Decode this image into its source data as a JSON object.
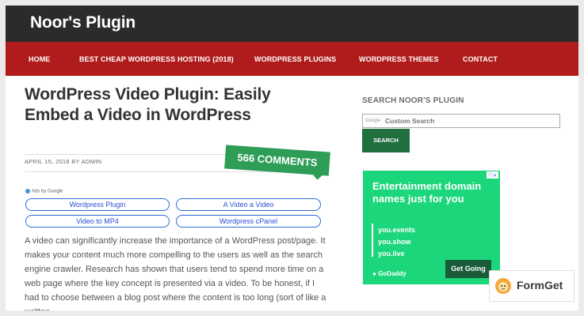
{
  "site": {
    "title": "Noor's Plugin"
  },
  "nav": {
    "items": [
      {
        "label": "HOME"
      },
      {
        "label": "BEST CHEAP WORDPRESS HOSTING (2018)"
      },
      {
        "label": "WORDPRESS PLUGINS"
      },
      {
        "label": "WORDPRESS THEMES"
      },
      {
        "label": "CONTACT"
      }
    ]
  },
  "post": {
    "title_line1": "WordPress Video Plugin: Easily",
    "title_line2": "Embed a Video in WordPress",
    "meta": "APRIL 15, 2018 BY ADMIN",
    "comments": "566 COMMENTS",
    "body": "A video can significantly increase the importance of a WordPress post/page. It makes your content much more compelling to the users as well as the search engine crawler. Research has shown that users tend to spend more time on a web page where the key concept is presented via a video. To be honest, if I had to choose between a blog post where the content is too long (sort of like a written"
  },
  "ads": {
    "label": "Ads by Google",
    "links": [
      {
        "label": "Wordpress Plugin"
      },
      {
        "label": "A Video a Video"
      },
      {
        "label": "Video to MP4"
      },
      {
        "label": "Wordpress cPanel"
      }
    ]
  },
  "sidebar": {
    "title": "SEARCH NOOR'S PLUGIN",
    "search": {
      "google_mark": "Google",
      "placeholder": "Custom Search",
      "button": "SEARCH"
    },
    "banner": {
      "choices": "ⓘ✕",
      "headline": "Entertainment domain names just for you",
      "domains": [
        "you.events",
        "you.show",
        "you.live"
      ],
      "logo": "GoDaddy",
      "cta": "Get Going"
    }
  },
  "watermark": {
    "text": "FormGet"
  },
  "colors": {
    "nav": "#b01c1c",
    "header": "#2b2b2b",
    "accent_green": "#2e9e57",
    "banner": "#1bd67a"
  }
}
